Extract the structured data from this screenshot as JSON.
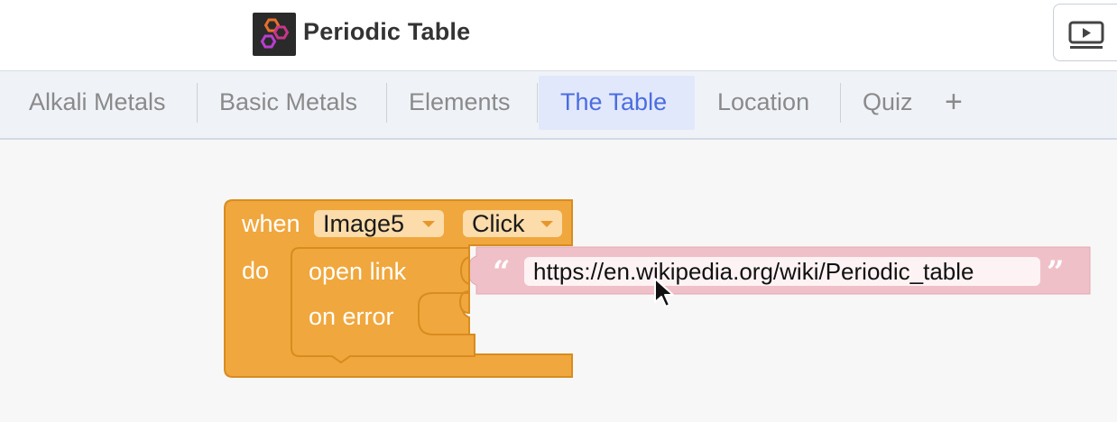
{
  "header": {
    "title": "Periodic Table",
    "logo_icon": "hexagons-logo-icon",
    "preview_icon": "play-preview-icon"
  },
  "tabs": [
    {
      "label": "Alkali Metals",
      "active": false
    },
    {
      "label": "Basic Metals",
      "active": false
    },
    {
      "label": "Elements",
      "active": false
    },
    {
      "label": "The Table",
      "active": true
    },
    {
      "label": "Location",
      "active": false
    },
    {
      "label": "Quiz",
      "active": false
    }
  ],
  "add_tab_label": "+",
  "blocks": {
    "event": {
      "when_label": "when",
      "component": "Image5",
      "event_name": "Click",
      "do_label": "do"
    },
    "open_link": {
      "label": "open link",
      "on_error_label": "on error"
    },
    "text": {
      "open_quote": "“",
      "value": "https://en.wikipedia.org/wiki/Periodic_table",
      "close_quote": "”"
    }
  },
  "colors": {
    "event_block": "#f0a73d",
    "event_block_border": "#d88c20",
    "text_block": "#f0c0c8",
    "active_tab": "#4a6ee0"
  }
}
